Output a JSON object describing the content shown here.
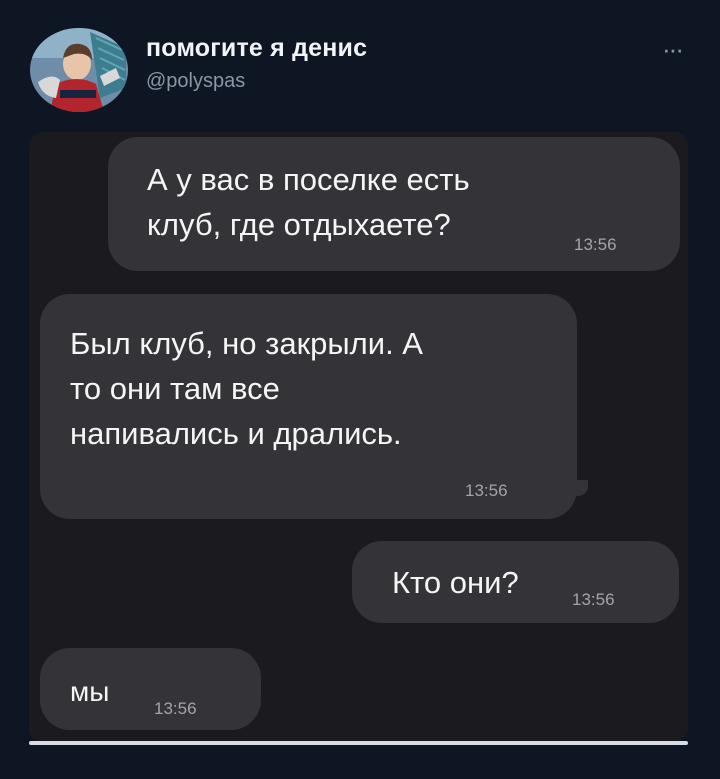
{
  "tweet": {
    "display_name": "помогите я денис",
    "handle": "@polyspas",
    "more_icon": "more-dots-icon"
  },
  "messages": [
    {
      "direction": "outgoing",
      "lines": [
        "А у вас в поселке есть",
        "клуб, где отдыхаете?"
      ],
      "time": "13:56"
    },
    {
      "direction": "incoming",
      "lines": [
        "Был клуб, но закрыли. А",
        "то они там все",
        "напивались и дрались."
      ],
      "time": "13:56"
    },
    {
      "direction": "outgoing",
      "lines": [
        "Кто они?"
      ],
      "time": "13:56"
    },
    {
      "direction": "incoming",
      "lines": [
        "мы"
      ],
      "time": "13:56"
    }
  ]
}
